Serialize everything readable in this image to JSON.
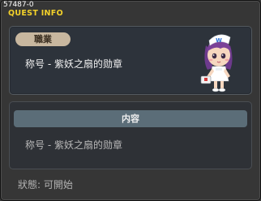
{
  "window": {
    "quest_id": "57487-0",
    "title": "QUEST INFO"
  },
  "summary": {
    "tag_label": "職業",
    "quest_title": "称号 - 紫妖之扇的勋章",
    "npc_icon": "npc-nurse-portrait-icon"
  },
  "content": {
    "header": "内容",
    "text": "称号 - 紫妖之扇的勋章"
  },
  "status": {
    "text": "狀態: 可開始"
  },
  "colors": {
    "title": "#f4d22a",
    "tag_bg": "#c8b79f",
    "content_bar": "#5b6d78"
  }
}
